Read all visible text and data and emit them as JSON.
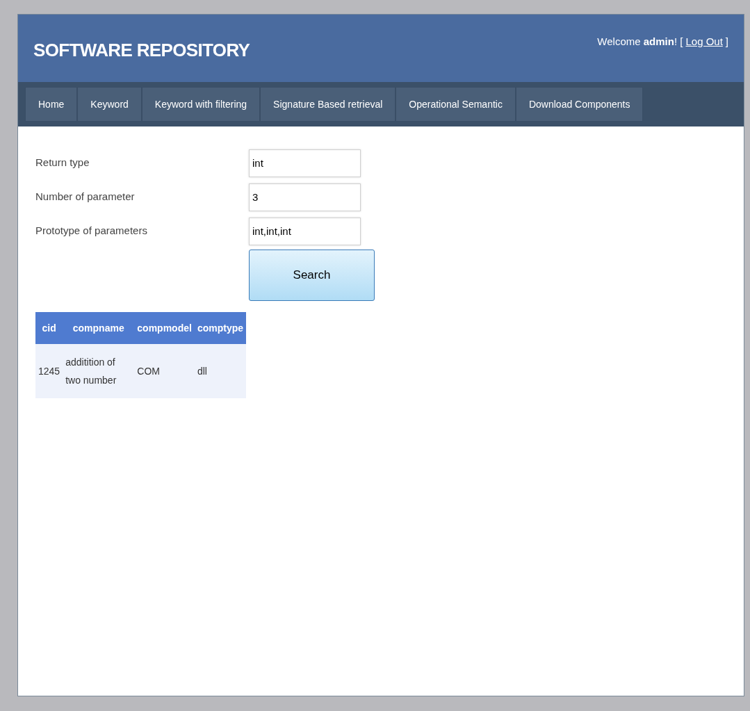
{
  "header": {
    "title": "SOFTWARE REPOSITORY",
    "welcome": "Welcome **admin**! [",
    "logout": "Log Out",
    "welcome_end": "]"
  },
  "nav": [
    "Home",
    "Keyword",
    "Keyword with filtering",
    "Signature Based retrieval",
    "Operational Semantic",
    "Download Components"
  ],
  "form": {
    "fields": [
      {
        "label": "Return type",
        "value": "int"
      },
      {
        "label": "Number of parameter",
        "value": "3"
      },
      {
        "label": "Prototype of parameters",
        "value": "int,int,int"
      }
    ],
    "button": "Search"
  },
  "table": {
    "columns": [
      "cid",
      "compname",
      "compmodel",
      "comptype"
    ],
    "rows": [
      [
        "1245",
        "additition of two number",
        "COM",
        "dll"
      ]
    ]
  }
}
